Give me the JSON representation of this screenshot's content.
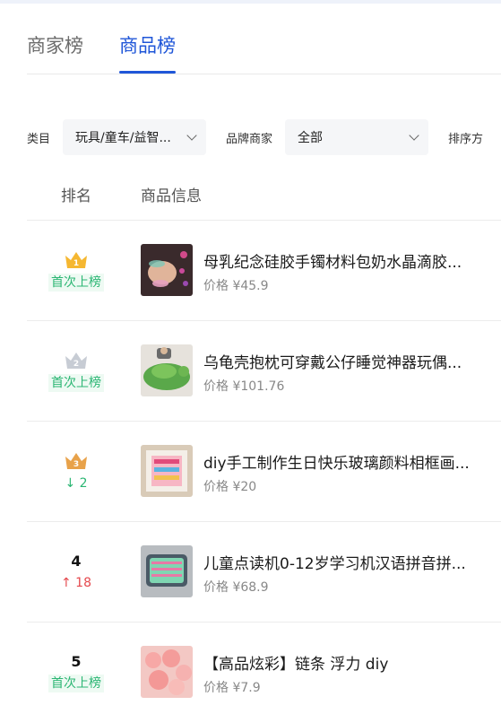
{
  "tabs": [
    {
      "label": "商家榜",
      "active": false
    },
    {
      "label": "商品榜",
      "active": true
    }
  ],
  "filters": {
    "category_label": "类目",
    "category_value": "玩具/童车/益智...",
    "brand_label": "品牌商家",
    "brand_value": "全部",
    "sort_label": "排序方"
  },
  "table": {
    "col_rank": "排名",
    "col_info": "商品信息"
  },
  "price_prefix": "价格",
  "rows": [
    {
      "rank": "1",
      "crown": "gold",
      "status": "首次上榜",
      "title": "母乳纪念硅胶手镯材料包奶水晶滴胶...",
      "price": "¥45.9"
    },
    {
      "rank": "2",
      "crown": "silver",
      "status": "首次上榜",
      "title": "乌龟壳抱枕可穿戴公仔睡觉神器玩偶...",
      "price": "¥101.76"
    },
    {
      "rank": "3",
      "crown": "bronze",
      "status": "↓ 2",
      "title": "diy手工制作生日快乐玻璃颜料相框画...",
      "price": "¥20"
    },
    {
      "rank": "4",
      "status": "↑ 18",
      "title": "儿童点读机0-12岁学习机汉语拼音拼...",
      "price": "¥68.9"
    },
    {
      "rank": "5",
      "status": "首次上榜",
      "title": "【高品炫彩】链条 浮力 diy",
      "price": "¥7.9"
    }
  ],
  "colors": {
    "accent": "#1f56d8",
    "gold": "#f5b731",
    "silver": "#c7ccd4",
    "bronze": "#e8a24a",
    "status_green": "#2bb673",
    "status_red": "#e5484d"
  }
}
